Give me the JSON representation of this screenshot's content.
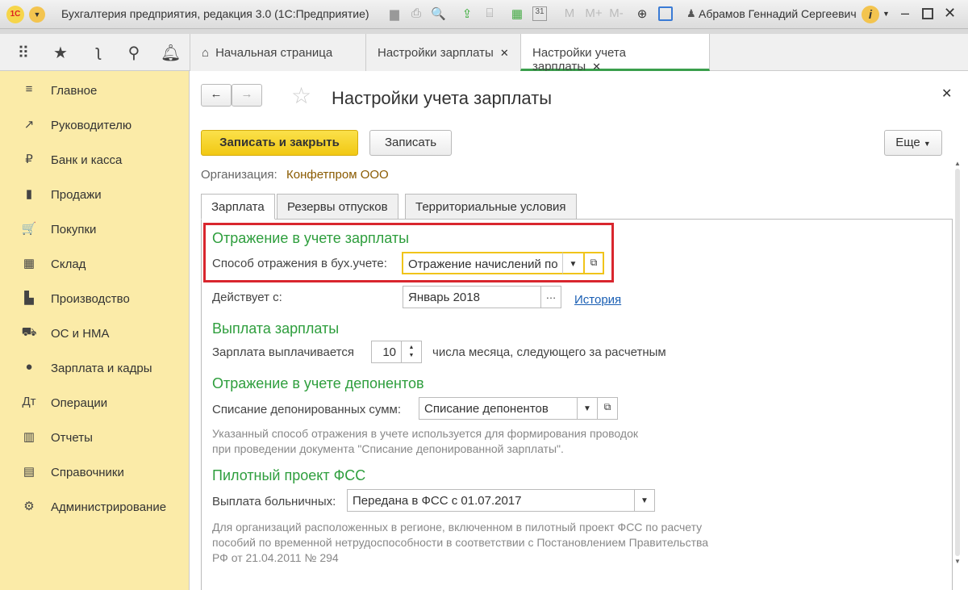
{
  "window": {
    "title": "Бухгалтерия предприятия, редакция 3.0  (1С:Предприятие)",
    "user": "Абрамов Геннадий Сергеевич",
    "logo": "1С",
    "m_buttons": [
      "M",
      "M+",
      "M-"
    ]
  },
  "tabs": [
    {
      "label": "Начальная страница"
    },
    {
      "label": "Настройки зарплаты"
    },
    {
      "label": "Настройки учета зарплаты"
    }
  ],
  "sidebar": {
    "items": [
      {
        "label": "Главное",
        "icon": "≡"
      },
      {
        "label": "Руководителю",
        "icon": "↗"
      },
      {
        "label": "Банк и касса",
        "icon": "₽"
      },
      {
        "label": "Продажи",
        "icon": "▮"
      },
      {
        "label": "Покупки",
        "icon": "🛒"
      },
      {
        "label": "Склад",
        "icon": "▦"
      },
      {
        "label": "Производство",
        "icon": "▙"
      },
      {
        "label": "ОС и НМА",
        "icon": "⛟"
      },
      {
        "label": "Зарплата и кадры",
        "icon": "●"
      },
      {
        "label": "Операции",
        "icon": "Дт"
      },
      {
        "label": "Отчеты",
        "icon": "▥"
      },
      {
        "label": "Справочники",
        "icon": "▤"
      },
      {
        "label": "Администрирование",
        "icon": "⚙"
      }
    ]
  },
  "form": {
    "title": "Настройки учета зарплаты",
    "save_close": "Записать и закрыть",
    "save": "Записать",
    "more": "Еще",
    "org_label": "Организация:",
    "org_value": "Конфетпром ООО",
    "tabs": [
      "Зарплата",
      "Резервы отпусков",
      "Территориальные условия"
    ],
    "s1": {
      "title": "Отражение в учете зарплаты",
      "label": "Способ отражения в бух.учете:",
      "value": "Отражение начислений по"
    },
    "active_label": "Действует с:",
    "active_value": "Январь 2018",
    "history": "История",
    "s2": {
      "title": "Выплата зарплаты",
      "label": "Зарплата выплачивается",
      "value": "10",
      "suffix": "числа месяца, следующего за расчетным"
    },
    "s3": {
      "title": "Отражение в учете депонентов",
      "label": "Списание депонированных сумм:",
      "value": "Списание депонентов",
      "note1": "Указанный способ отражения в учете используется для формирования проводок",
      "note2": "при проведении документа \"Списание депонированной зарплаты\"."
    },
    "s4": {
      "title": "Пилотный проект ФСС",
      "label": "Выплата больничных:",
      "value": "Передана в ФСС с 01.07.2017",
      "note1": "Для организаций расположенных в регионе, включенном в пилотный проект ФСС по расчету",
      "note2": "пособий по временной нетрудоспособности в соответствии с Постановлением Правительства",
      "note3": "РФ от 21.04.2011 № 294"
    }
  }
}
